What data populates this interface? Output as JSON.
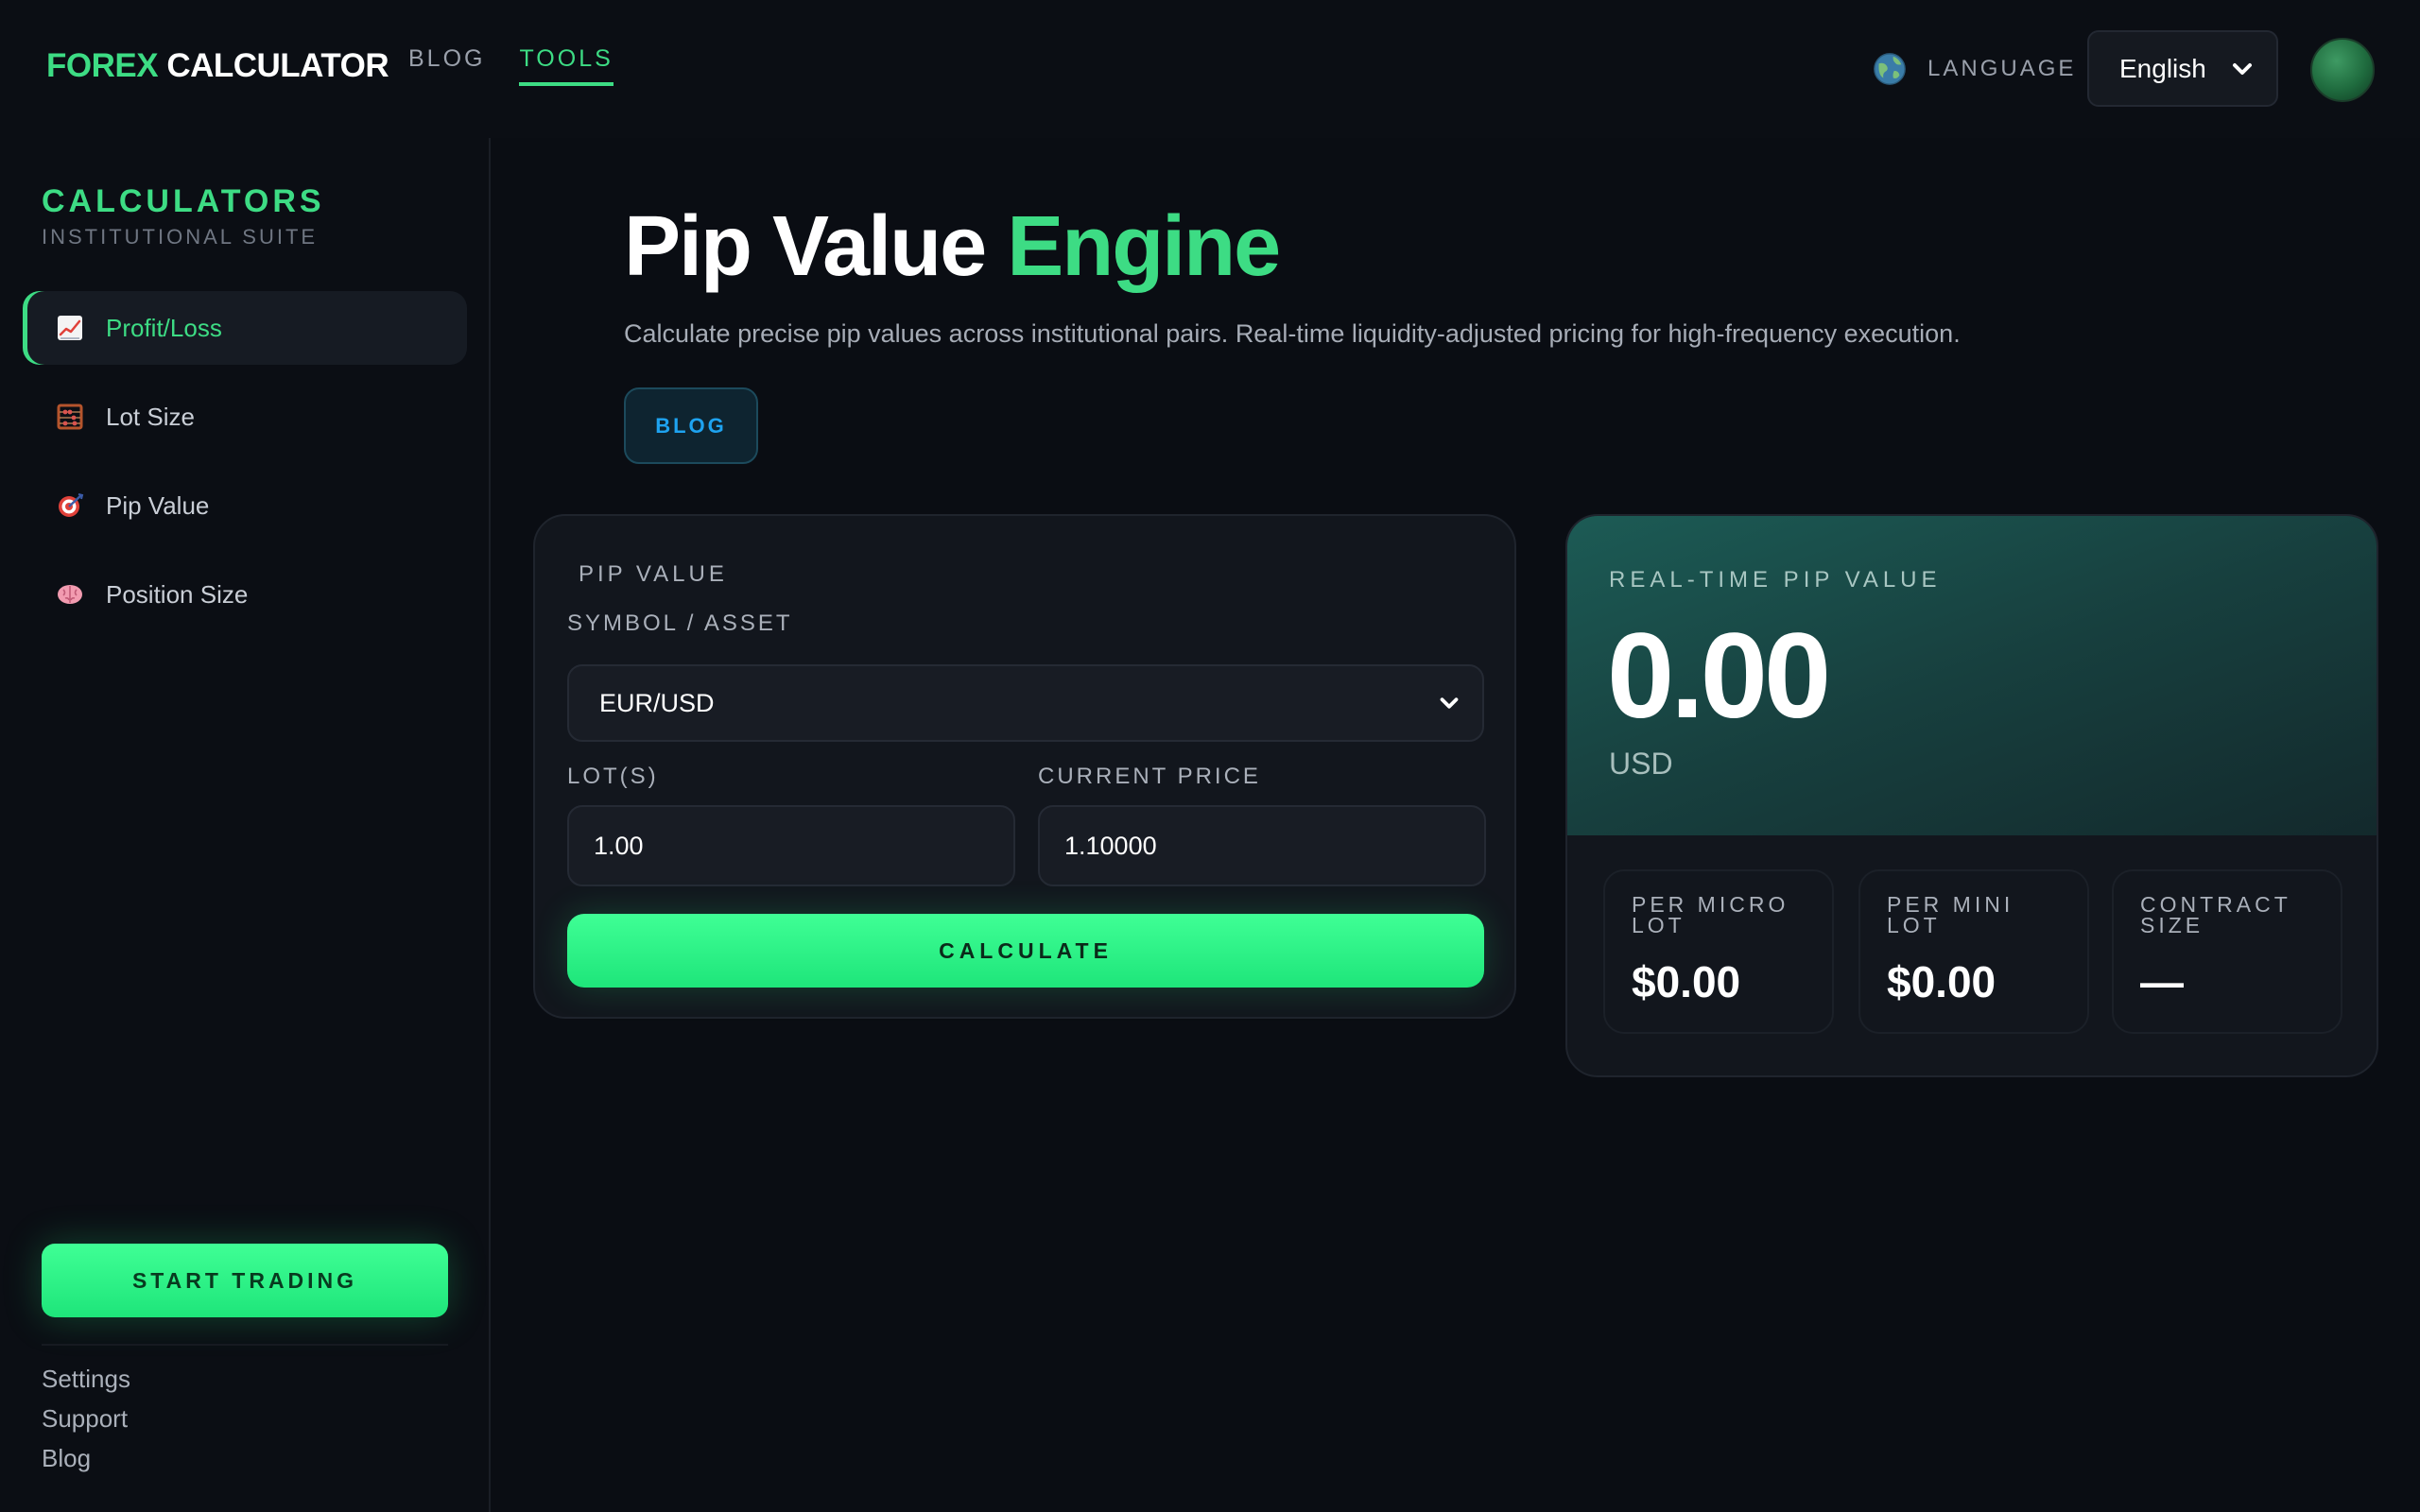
{
  "brand": {
    "part1": "FOREX",
    "part2": "CALCULATOR"
  },
  "topnav": [
    {
      "label": "BLOG",
      "active": false
    },
    {
      "label": "TOOLS",
      "active": true
    }
  ],
  "language": {
    "icon": "globe-icon",
    "label": "LANGUAGE",
    "selected": "English"
  },
  "colors": {
    "accent": "#3ddc84",
    "background": "#0a0d13",
    "info": "#1ea3f0"
  },
  "sidebar": {
    "title": "CALCULATORS",
    "subtitle": "INSTITUTIONAL SUITE",
    "items": [
      {
        "label": "Profit/Loss",
        "icon": "chart-increasing-icon",
        "active": true
      },
      {
        "label": "Lot Size",
        "icon": "abacus-icon",
        "active": false
      },
      {
        "label": "Pip Value",
        "icon": "target-icon",
        "active": false
      },
      {
        "label": "Position Size",
        "icon": "brain-icon",
        "active": false
      }
    ],
    "cta": "START TRADING",
    "links": [
      "Settings",
      "Support",
      "Blog"
    ]
  },
  "page": {
    "title_white": "Pip Value",
    "title_green": "Engine",
    "description": "Calculate precise pip values across institutional pairs. Real-time liquidity-adjusted pricing for high-frequency execution.",
    "blog_button": "BLOG"
  },
  "form": {
    "title": "PIP VALUE",
    "symbol_label": "SYMBOL / ASSET",
    "symbol_value": "EUR/USD",
    "lots_label": "LOT(S)",
    "lots_value": "1.00",
    "price_label": "CURRENT PRICE",
    "price_value": "1.10000",
    "submit": "CALCULATE"
  },
  "result": {
    "label": "REAL-TIME PIP VALUE",
    "value": "0.00",
    "unit": "USD",
    "stats": [
      {
        "label": "PER MICRO LOT",
        "value": "$0.00"
      },
      {
        "label": "PER MINI LOT",
        "value": "$0.00"
      },
      {
        "label": "CONTRACT SIZE",
        "value": "—"
      }
    ]
  }
}
